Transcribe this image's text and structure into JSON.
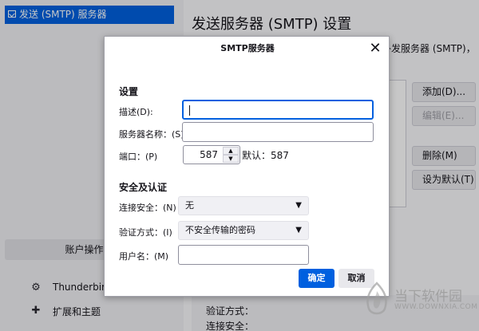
{
  "sidebar": {
    "selected_item": "发送 (SMTP) 服务器",
    "account_actions": "账户操作(A",
    "links": [
      {
        "icon": "gear-icon",
        "label": "Thunderbird"
      },
      {
        "icon": "puzzle-icon",
        "label": "扩展和主题"
      }
    ]
  },
  "main": {
    "title": "发送服务器 (SMTP) 设置",
    "desc_fragment": "外发服务器 (SMTP)，",
    "buttons": [
      "添加(D)...",
      "编辑(E)...",
      "删除(M)",
      "设为默认(T)"
    ],
    "details": [
      "验证方式：",
      "连接安全："
    ]
  },
  "dialog": {
    "title": "SMTP服务器",
    "settings_heading": "设置",
    "description_label": "描述(D):",
    "description_value": "",
    "server_label": "服务器名称：(S)",
    "server_value": "",
    "port_label": "端口：(P)",
    "port_value": "587",
    "default_port": "默认：587",
    "security_heading": "安全及认证",
    "conn_security_label": "连接安全：(N)",
    "conn_security_value": "无",
    "auth_label": "验证方式：(I)",
    "auth_value": "不安全传输的密码",
    "username_label": "用户名：(M)",
    "username_value": "",
    "ok_label": "确定",
    "cancel_label": "取消"
  },
  "watermark": {
    "line1": "当下软件园",
    "line2": "WWW.DOWNXIA.COM"
  },
  "colors": {
    "accent": "#0060df",
    "overlay": "rgba(0,0,0,0.22)"
  }
}
